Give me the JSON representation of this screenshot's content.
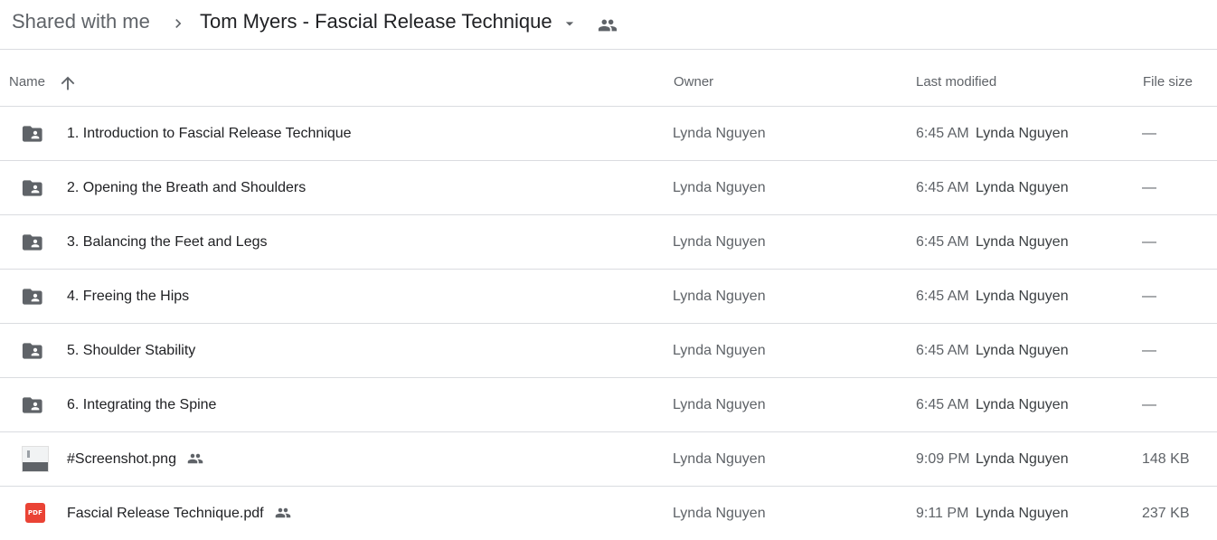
{
  "breadcrumb": {
    "root": "Shared with me",
    "current": "Tom Myers - Fascial Release Technique"
  },
  "columns": {
    "name": "Name",
    "owner": "Owner",
    "last_modified": "Last modified",
    "file_size": "File size"
  },
  "colors": {
    "pdf_red": "#ea4335",
    "folder_grey": "#5f6368",
    "divider": "#dadce0"
  },
  "files": [
    {
      "name": "1. Introduction to Fascial Release Technique",
      "type": "shared-folder",
      "shared": false,
      "owner": "Lynda Nguyen",
      "modified_time": "6:45 AM",
      "modified_by": "Lynda Nguyen",
      "size": "—"
    },
    {
      "name": "2. Opening the Breath and Shoulders",
      "type": "shared-folder",
      "shared": false,
      "owner": "Lynda Nguyen",
      "modified_time": "6:45 AM",
      "modified_by": "Lynda Nguyen",
      "size": "—"
    },
    {
      "name": "3. Balancing the Feet and Legs",
      "type": "shared-folder",
      "shared": false,
      "owner": "Lynda Nguyen",
      "modified_time": "6:45 AM",
      "modified_by": "Lynda Nguyen",
      "size": "—"
    },
    {
      "name": "4. Freeing the Hips",
      "type": "shared-folder",
      "shared": false,
      "owner": "Lynda Nguyen",
      "modified_time": "6:45 AM",
      "modified_by": "Lynda Nguyen",
      "size": "—"
    },
    {
      "name": "5. Shoulder Stability",
      "type": "shared-folder",
      "shared": false,
      "owner": "Lynda Nguyen",
      "modified_time": "6:45 AM",
      "modified_by": "Lynda Nguyen",
      "size": "—"
    },
    {
      "name": "6. Integrating the Spine",
      "type": "shared-folder",
      "shared": false,
      "owner": "Lynda Nguyen",
      "modified_time": "6:45 AM",
      "modified_by": "Lynda Nguyen",
      "size": "—"
    },
    {
      "name": "#Screenshot.png",
      "type": "image",
      "shared": true,
      "owner": "Lynda Nguyen",
      "modified_time": "9:09 PM",
      "modified_by": "Lynda Nguyen",
      "size": "148 KB"
    },
    {
      "name": "Fascial Release Technique.pdf",
      "type": "pdf",
      "icon_text": "PDF",
      "shared": true,
      "owner": "Lynda Nguyen",
      "modified_time": "9:11 PM",
      "modified_by": "Lynda Nguyen",
      "size": "237 KB"
    }
  ]
}
